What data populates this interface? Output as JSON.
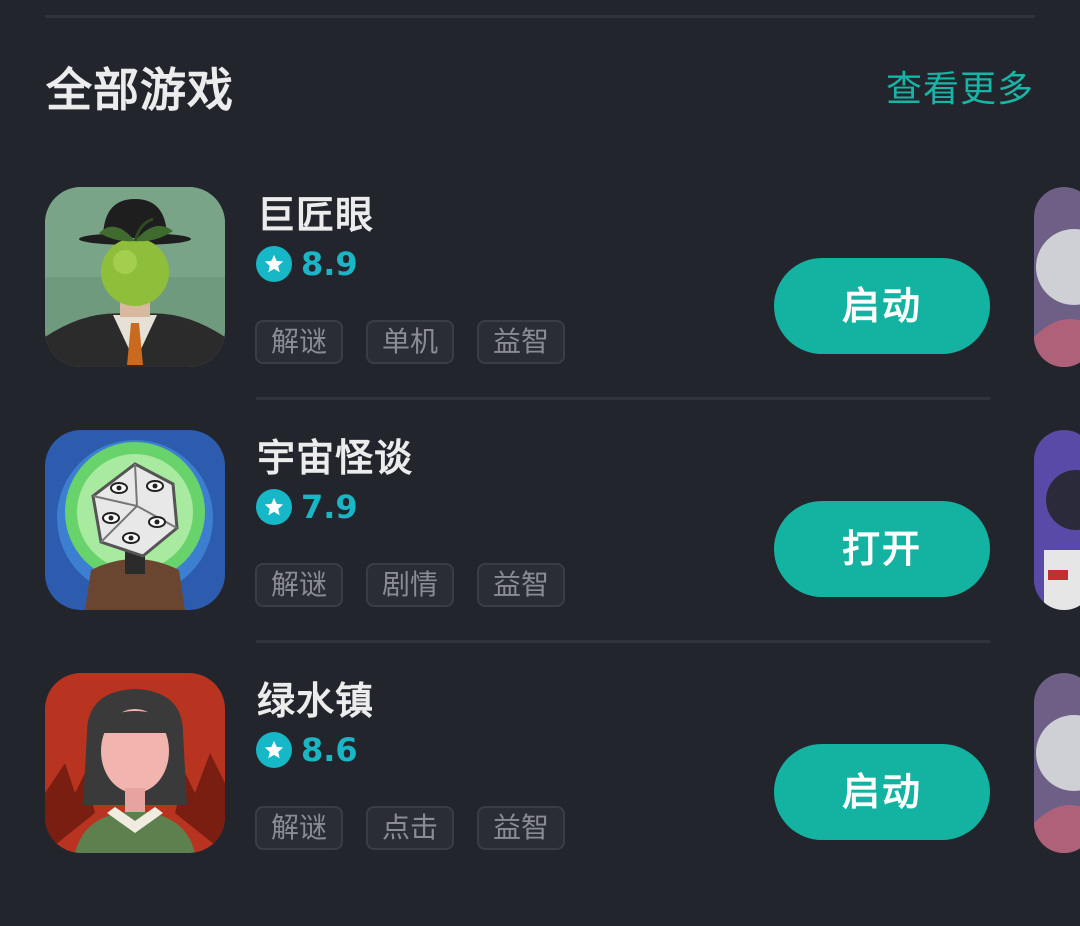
{
  "section": {
    "title": "全部游戏",
    "view_more": "查看更多"
  },
  "games": [
    {
      "name": "巨匠眼",
      "rating": "8.9",
      "tags": [
        "解谜",
        "单机",
        "益智"
      ],
      "action": "启动",
      "icon": "apple-face-man-icon"
    },
    {
      "name": "宇宙怪谈",
      "rating": "7.9",
      "tags": [
        "解谜",
        "剧情",
        "益智"
      ],
      "action": "打开",
      "icon": "dice-head-man-icon"
    },
    {
      "name": "绿水镇",
      "rating": "8.6",
      "tags": [
        "解谜",
        "点击",
        "益智"
      ],
      "action": "启动",
      "icon": "faceless-girl-icon"
    }
  ],
  "colors": {
    "background": "#23252d",
    "accent": "#14b3a1",
    "rating": "#16b8c7",
    "text": "#ececec",
    "tag_text": "#8a8c92"
  }
}
